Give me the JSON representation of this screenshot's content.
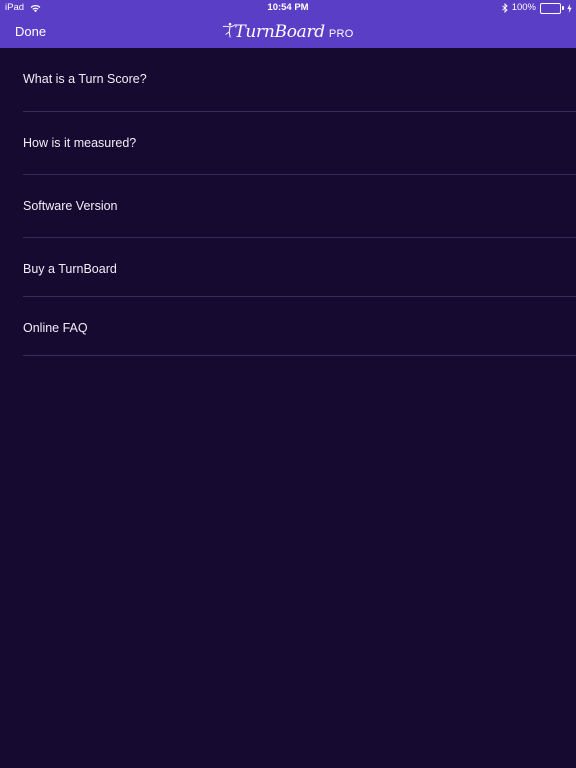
{
  "status_bar": {
    "device": "iPad",
    "time": "10:54 PM",
    "battery": "100%",
    "battery_level": 1.0,
    "icons": [
      "wifi-icon",
      "bluetooth-icon",
      "battery-icon",
      "charging-icon"
    ]
  },
  "nav": {
    "done_label": "Done",
    "logo_text": "TurnBoard",
    "logo_suffix": "PRO",
    "logo_icon": "dancer-icon"
  },
  "menu": {
    "items": [
      {
        "label": "What is a Turn Score?"
      },
      {
        "label": "How is it measured?"
      },
      {
        "label": "Software Version"
      },
      {
        "label": "Buy a TurnBoard"
      },
      {
        "label": "Online FAQ"
      }
    ]
  },
  "colors": {
    "header": "#5a3ec6",
    "background": "#170a31",
    "divider": "#3a2d55",
    "battery": "#4cd964"
  }
}
